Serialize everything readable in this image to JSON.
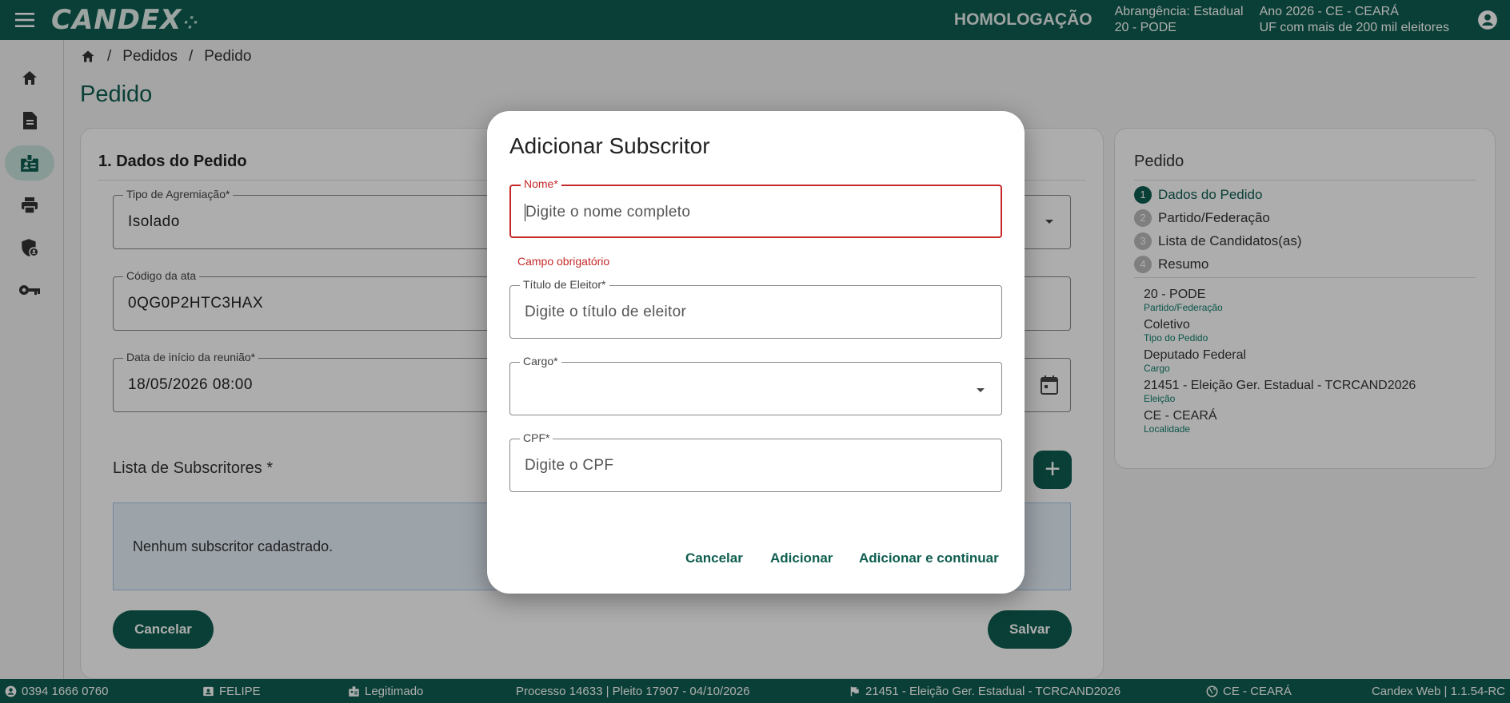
{
  "header": {
    "logo_text": "CANDEX",
    "environment": "HOMOLOGAÇÃO",
    "scope_line1": "Abrangência: Estadual",
    "scope_line2": "20 - PODE",
    "election_line1": "Ano 2026 - CE - CEARÁ",
    "election_line2": "UF com mais de 200 mil eleitores"
  },
  "breadcrumb": {
    "sep": "/",
    "items": [
      "Pedidos",
      "Pedido"
    ]
  },
  "page_title": "Pedido",
  "form": {
    "section_title": "1. Dados do Pedido",
    "tipo_agremiacao": {
      "label": "Tipo de Agremiação*",
      "value": "Isolado"
    },
    "codigo_ata": {
      "label": "Código da ata",
      "value": "0QG0P2HTC3HAX"
    },
    "data_inicio": {
      "label": "Data de início da reunião*",
      "value": "18/05/2026 08:00"
    },
    "subscritores_title": "Lista de Subscritores *",
    "add_symbol": "+",
    "empty_message": "Nenhum subscritor cadastrado.",
    "cancel_label": "Cancelar",
    "save_label": "Salvar"
  },
  "summary": {
    "title": "Pedido",
    "steps": [
      {
        "num": "1",
        "label": "Dados do Pedido",
        "active": true
      },
      {
        "num": "2",
        "label": "Partido/Federação",
        "active": false
      },
      {
        "num": "3",
        "label": "Lista de Candidatos(as)",
        "active": false
      },
      {
        "num": "4",
        "label": "Resumo",
        "active": false
      }
    ],
    "items": [
      {
        "value": "20 - PODE",
        "label": "Partido/Federação"
      },
      {
        "value": "Coletivo",
        "label": "Tipo do Pedido"
      },
      {
        "value": "Deputado Federal",
        "label": "Cargo"
      },
      {
        "value": "21451 - Eleição Ger. Estadual - TCRCAND2026",
        "label": "Eleição"
      },
      {
        "value": "CE - CEARÁ",
        "label": "Localidade"
      }
    ]
  },
  "dialog": {
    "title": "Adicionar Subscritor",
    "nome": {
      "label": "Nome*",
      "placeholder": "Digite o nome completo",
      "error": "Campo obrigatório"
    },
    "titulo": {
      "label": "Título de Eleitor*",
      "placeholder": "Digite o título de eleitor"
    },
    "cargo": {
      "label": "Cargo*",
      "value": ""
    },
    "cpf": {
      "label": "CPF*",
      "placeholder": "Digite o CPF"
    },
    "cancel_label": "Cancelar",
    "add_label": "Adicionar",
    "add_continue_label": "Adicionar e continuar"
  },
  "footer": {
    "ip": "0394 1666 0760",
    "user": "FELIPE",
    "role": "Legitimado",
    "process": "Processo 14633 | Pleito 17907 - 04/10/2026",
    "election": "21451 - Eleição Ger. Estadual - TCRCAND2026",
    "locale": "CE - CEARÁ",
    "version": "Candex Web | 1.1.54-RC"
  },
  "colors": {
    "primary": "#0e5e50",
    "error": "#c62828",
    "info_bg": "#e6f0fa"
  }
}
